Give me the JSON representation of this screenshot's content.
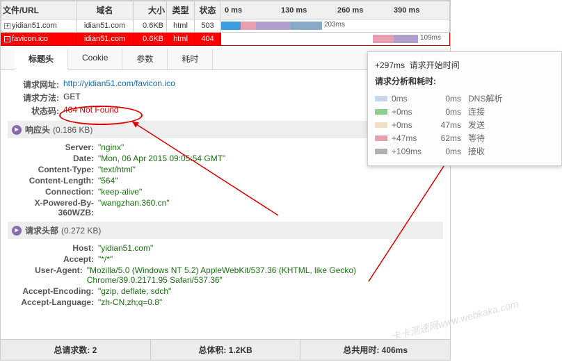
{
  "columns": {
    "file": "文件/URL",
    "domain": "域名",
    "size": "大小",
    "type": "类型",
    "status": "状态"
  },
  "timeline_ticks": [
    "0 ms",
    "130 ms",
    "260 ms",
    "390 ms"
  ],
  "rows": [
    {
      "file": "yidian51.com",
      "domain": "idian51.com",
      "size": "0.6KB",
      "type": "html",
      "status": "503",
      "bar_label": "203ms"
    },
    {
      "file": "favicon.ico",
      "domain": "idian51.com",
      "size": "0.6KB",
      "type": "html",
      "status": "404",
      "bar_label": "109ms"
    }
  ],
  "tabs": [
    {
      "label": "标题头",
      "active": true
    },
    {
      "label": "Cookie",
      "active": false
    },
    {
      "label": "参数",
      "active": false
    },
    {
      "label": "耗时",
      "active": false
    }
  ],
  "general": {
    "url_label": "请求网址:",
    "url_value": "http://yidian51.com/favicon.ico",
    "method_label": "请求方法:",
    "method_value": "GET",
    "status_label": "状态码:",
    "status_value": "404 Not Found"
  },
  "response_head": {
    "title": "响应头",
    "size": "(0.186 KB)",
    "items": [
      {
        "k": "Server:",
        "v": "\"nginx\""
      },
      {
        "k": "Date:",
        "v": "\"Mon, 06 Apr 2015 09:05:54 GMT\""
      },
      {
        "k": "Content-Type:",
        "v": "\"text/html\""
      },
      {
        "k": "Content-Length:",
        "v": "\"564\""
      },
      {
        "k": "Connection:",
        "v": "\"keep-alive\""
      },
      {
        "k": "X-Powered-By-360WZB:",
        "v": "\"wangzhan.360.cn\""
      }
    ]
  },
  "request_head": {
    "title": "请求头部",
    "size": "(0.272 KB)",
    "items": [
      {
        "k": "Host:",
        "v": "\"yidian51.com\""
      },
      {
        "k": "Accept:",
        "v": "\"*/*\""
      },
      {
        "k": "User-Agent:",
        "v": "\"Mozilla/5.0 (Windows NT 5.2) AppleWebKit/537.36 (KHTML, like Gecko) Chrome/39.0.2171.95 Safari/537.36\""
      },
      {
        "k": "Accept-Encoding:",
        "v": "\"gzip, deflate, sdch\""
      },
      {
        "k": "Accept-Language:",
        "v": "\"zh-CN,zh;q=0.8\""
      }
    ]
  },
  "footer": {
    "total_req_label": "总请求数:",
    "total_req_value": "2",
    "total_size_label": "总体积:",
    "total_size_value": "1.2KB",
    "total_time_label": "总共用时:",
    "total_time_value": "406ms"
  },
  "popup": {
    "start_offset": "+297ms",
    "start_label": "请求开始时间",
    "section_label": "请求分析和耗时:",
    "rows": [
      {
        "color": "#c8d8e8",
        "c1": "0ms",
        "c2": "0ms",
        "c3": "DNS解析"
      },
      {
        "color": "#8dd08d",
        "c1": "+0ms",
        "c2": "0ms",
        "c3": "连接"
      },
      {
        "color": "#f0e0c0",
        "c1": "+0ms",
        "c2": "47ms",
        "c3": "发送"
      },
      {
        "color": "#e89fb0",
        "c1": "+47ms",
        "c2": "62ms",
        "c3": "等待"
      },
      {
        "color": "#b0b0b0",
        "c1": "+109ms",
        "c2": "0ms",
        "c3": "接收"
      }
    ]
  },
  "watermark": "卡卡测速网www.webkaka.com"
}
